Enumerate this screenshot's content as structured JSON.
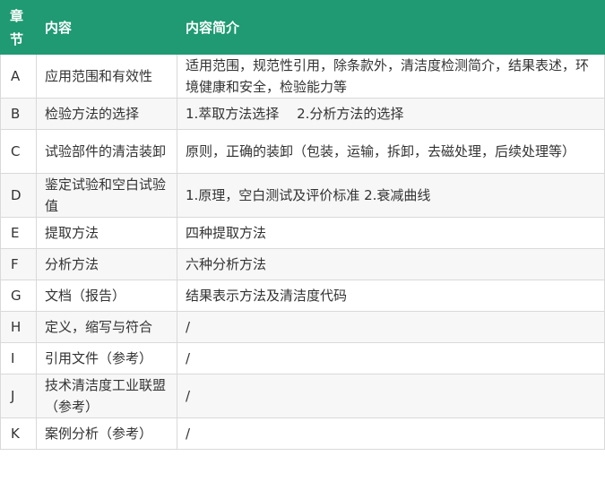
{
  "header": {
    "chapter": "章节",
    "content": "内容",
    "summary": "内容简介"
  },
  "rows": [
    {
      "chapter": "A",
      "content": "应用范围和有效性",
      "summary": "适用范围，规范性引用，除条款外，清洁度检测简介，结果表述，环境健康和安全，检验能力等"
    },
    {
      "chapter": "B",
      "content": "检验方法的选择",
      "summary": "1.萃取方法选择　 2.分析方法的选择"
    },
    {
      "chapter": "C",
      "content": "试验部件的清洁装卸",
      "summary": "原则，正确的装卸（包装，运输，拆卸，去磁处理，后续处理等）"
    },
    {
      "chapter": "D",
      "content": "鉴定试验和空白试验值",
      "summary": "1.原理，空白测试及评价标准 2.衰减曲线"
    },
    {
      "chapter": "E",
      "content": "提取方法",
      "summary": "四种提取方法"
    },
    {
      "chapter": "F",
      "content": "分析方法",
      "summary": "六种分析方法"
    },
    {
      "chapter": "G",
      "content": "文档（报告）",
      "summary": "结果表示方法及清洁度代码"
    },
    {
      "chapter": "H",
      "content": "定义，缩写与符合",
      "summary": "/"
    },
    {
      "chapter": "I",
      "content": "引用文件（参考）",
      "summary": "/"
    },
    {
      "chapter": "J",
      "content": "技术清洁度工业联盟（参考）",
      "summary": "/"
    },
    {
      "chapter": "K",
      "content": "案例分析（参考）",
      "summary": "/"
    }
  ],
  "colors": {
    "header_bg": "#1f9a72",
    "header_text": "#ffffff",
    "border": "#d9d9d9",
    "row_alt_bg": "#f7f7f7",
    "text": "#333333"
  }
}
